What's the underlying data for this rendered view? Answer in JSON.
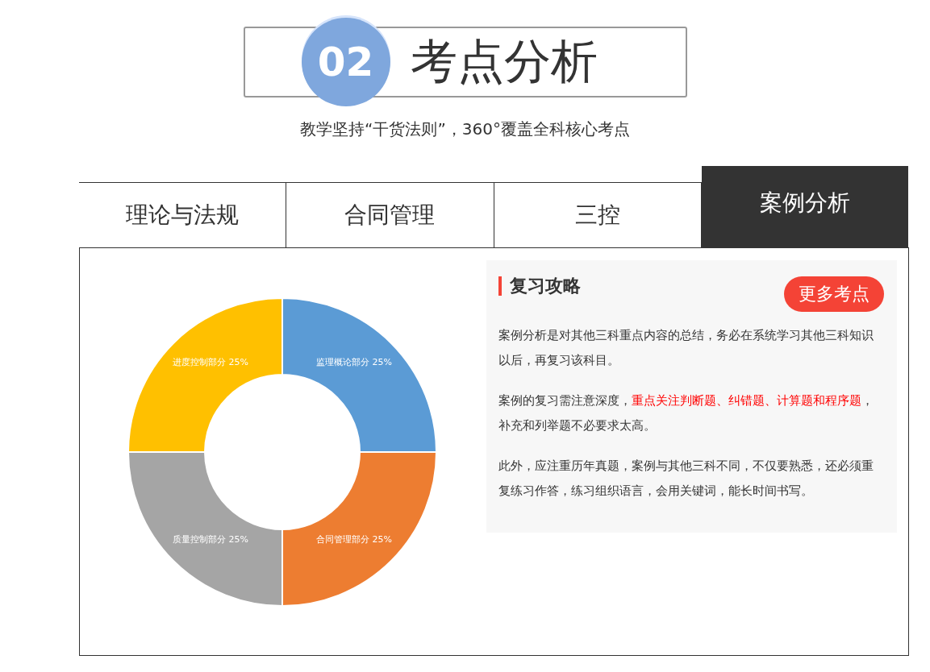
{
  "header": {
    "number": "02",
    "title": "考点分析",
    "subtitle": "教学坚持“干货法则”，360°覆盖全科核心考点"
  },
  "tabs": [
    {
      "label": "理论与法规",
      "selected": false
    },
    {
      "label": "合同管理",
      "selected": false
    },
    {
      "label": "三控",
      "selected": false
    },
    {
      "label": "案例分析",
      "selected": true
    }
  ],
  "chart_data": {
    "type": "donut",
    "categories": [
      "监理概论部分",
      "合同管理部分",
      "质量控制部分",
      "进度控制部分"
    ],
    "values": [
      25,
      25,
      25,
      25
    ],
    "colors": [
      "#5b9bd5",
      "#ed7d31",
      "#a5a5a5",
      "#ffc000"
    ],
    "value_labels": [
      "25%",
      "25%",
      "25%",
      "25%"
    ]
  },
  "panel": {
    "title": "复习攻略",
    "more_button": "更多考点",
    "paragraphs": [
      [
        {
          "text": "案例分析是对其他三科重点内容的总结，务必在系统学习其他三科知识以后，再复习该科目。",
          "highlight": false
        }
      ],
      [
        {
          "text": "案例的复习需注意深度，",
          "highlight": false
        },
        {
          "text": "重点关注判断题、纠错题、计算题和程序题",
          "highlight": true
        },
        {
          "text": "，补充和列举题不必要求太高。",
          "highlight": false
        }
      ],
      [
        {
          "text": "此外，应注重历年真题，案例与其他三科不同，不仅要熟悉，还必须重复练习作答，练习组织语言，会用关键词，能长时间书写。",
          "highlight": false
        }
      ]
    ]
  }
}
